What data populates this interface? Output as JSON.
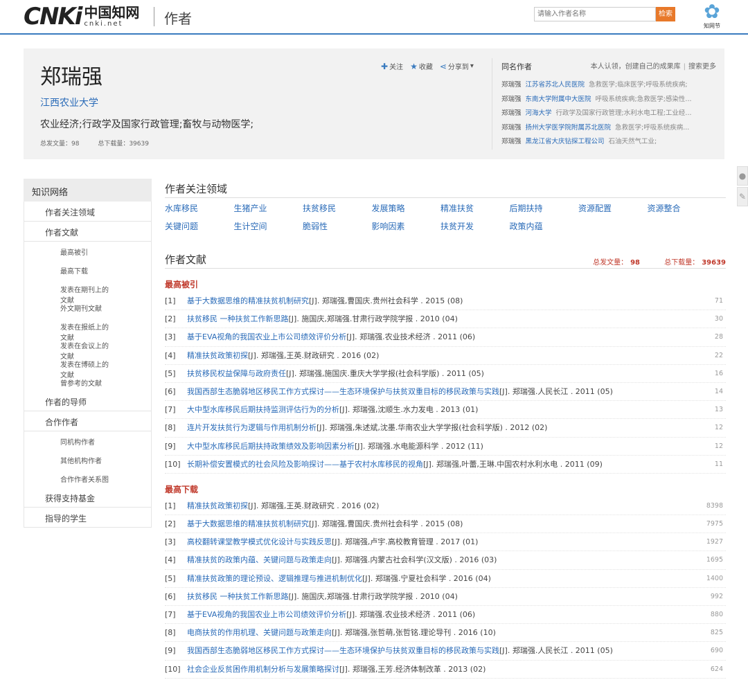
{
  "header": {
    "logo_cnki": "CNKi",
    "logo_zh": "中国知网",
    "logo_en": "cnki.net",
    "title": "作者",
    "search_placeholder": "请输入作者名称",
    "search_button": "检索",
    "brand_label": "知网节"
  },
  "author": {
    "name": "郑瑞强",
    "org": "江西农业大学",
    "fields": "农业经济;行政学及国家行政管理;畜牧与动物医学;",
    "stat_articles": "总发文量：98",
    "stat_downloads": "总下载量：39639",
    "actions": [
      "关注",
      "收藏",
      "分享到"
    ]
  },
  "same_name": {
    "title": "同名作者",
    "certify": "本人认领，创建自己的成果库",
    "search_more": "搜索更多",
    "rows": [
      {
        "name": "郑瑞强",
        "org": "江苏省苏北人民医院",
        "field": "急救医学;临床医学;呼吸系统疾病;"
      },
      {
        "name": "郑瑞强",
        "org": "东南大学附属中大医院",
        "field": "呼吸系统疾病;急救医学;感染性..."
      },
      {
        "name": "郑瑞强",
        "org": "河海大学",
        "field": "行政学及国家行政管理;水利水电工程;工业经..."
      },
      {
        "name": "郑瑞强",
        "org": "扬州大学医学院附属苏北医院",
        "field": "急救医学;呼吸系统疾病..."
      },
      {
        "name": "郑瑞强",
        "org": "黑龙江省大庆钻探工程公司",
        "field": "石油天然气工业;"
      }
    ]
  },
  "sidebar": {
    "head": "知识网络",
    "items": [
      {
        "label": "作者关注领域",
        "level": 1
      },
      {
        "label": "作者文献",
        "level": 1
      },
      {
        "label": "最高被引",
        "level": 2
      },
      {
        "label": "最高下载",
        "level": 2
      },
      {
        "label": "发表在期刊上的文献",
        "level": 2
      },
      {
        "label": "外文期刊文献",
        "level": 2
      },
      {
        "label": "发表在报纸上的文献",
        "level": 2
      },
      {
        "label": "发表在会议上的文献",
        "level": 2
      },
      {
        "label": "发表在博硕上的文献",
        "level": 2
      },
      {
        "label": "曾参考的文献",
        "level": 2
      },
      {
        "label": "作者的导师",
        "level": 1
      },
      {
        "label": "合作作者",
        "level": 1
      },
      {
        "label": "同机构作者",
        "level": 2
      },
      {
        "label": "其他机构作者",
        "level": 2
      },
      {
        "label": "合作作者关系图",
        "level": 2
      },
      {
        "label": "获得支持基金",
        "level": 1
      },
      {
        "label": "指导的学生",
        "level": 1
      }
    ]
  },
  "focus": {
    "title": "作者关注领域",
    "keywords": [
      "水库移民",
      "生猪产业",
      "扶贫移民",
      "发展策略",
      "精准扶贫",
      "后期扶持",
      "资源配置",
      "资源整合",
      "关键问题",
      "生计空间",
      "脆弱性",
      "影响因素",
      "扶贫开发",
      "政策内蕴"
    ]
  },
  "docs": {
    "title": "作者文献",
    "stat_articles_label": "总发文量：",
    "stat_articles": "98",
    "stat_downloads_label": "总下载量：",
    "stat_downloads": "39639",
    "groups": [
      {
        "title": "最高被引",
        "rows": [
          {
            "idx": "[1]",
            "title": "基于大数据思维的精准扶贫机制研究",
            "meta": "[J]. 郑瑞强,曹国庆.贵州社会科学 . 2015 (08)",
            "count": "71"
          },
          {
            "idx": "[2]",
            "title": "扶贫移民 一种扶贫工作新思路",
            "meta": "[J]. 施国庆,郑瑞强.甘肃行政学院学报 . 2010 (04)",
            "count": "30"
          },
          {
            "idx": "[3]",
            "title": "基于EVA视角的我国农业上市公司绩效评价分析",
            "meta": "[J]. 郑瑞强.农业技术经济 . 2011 (06)",
            "count": "28"
          },
          {
            "idx": "[4]",
            "title": "精准扶贫政策初探",
            "meta": "[J]. 郑瑞强,王英.财政研究 . 2016 (02)",
            "count": "22"
          },
          {
            "idx": "[5]",
            "title": "扶贫移民权益保障与政府责任",
            "meta": "[J]. 郑瑞强,施国庆.重庆大学学报(社会科学版) . 2011 (05)",
            "count": "16"
          },
          {
            "idx": "[6]",
            "title": "我国西部生态脆弱地区移民工作方式探讨——生态环境保护与扶贫双重目标的移民政策与实践",
            "meta": "[J]. 郑瑞强.人民长江 . 2011 (05)",
            "count": "14"
          },
          {
            "idx": "[7]",
            "title": "大中型水库移民后期扶持监测评估行为的分析",
            "meta": "[J]. 郑瑞强,沈顺生.水力发电 . 2013 (01)",
            "count": "13"
          },
          {
            "idx": "[8]",
            "title": "连片开发扶贫行为逻辑与作用机制分析",
            "meta": "[J]. 郑瑞强,朱述斌,沈墨.华南农业大学学报(社会科学版) . 2012 (02)",
            "count": "12"
          },
          {
            "idx": "[9]",
            "title": "大中型水库移民后期扶持政策绩效及影响因素分析",
            "meta": "[J]. 郑瑞强.水电能源科学 . 2012 (11)",
            "count": "12"
          },
          {
            "idx": "[10]",
            "title": "长期补偿安置模式的社会风险及影响探讨——基于农村水库移民的视角",
            "meta": "[J]. 郑瑞强,叶蕾,王琳.中国农村水利水电 . 2011 (09)",
            "count": "11"
          }
        ]
      },
      {
        "title": "最高下载",
        "rows": [
          {
            "idx": "[1]",
            "title": "精准扶贫政策初探",
            "meta": "[J]. 郑瑞强,王英.财政研究 . 2016 (02)",
            "count": "8398"
          },
          {
            "idx": "[2]",
            "title": "基于大数据思维的精准扶贫机制研究",
            "meta": "[J]. 郑瑞强,曹国庆.贵州社会科学 . 2015 (08)",
            "count": "7975"
          },
          {
            "idx": "[3]",
            "title": "高校翻转课堂教学模式优化设计与实践反思",
            "meta": "[J]. 郑瑞强,卢宇.高校教育管理 . 2017 (01)",
            "count": "1927"
          },
          {
            "idx": "[4]",
            "title": "精准扶贫的政策内蕴、关键问题与政策走向",
            "meta": "[J]. 郑瑞强.内蒙古社会科学(汉文版) . 2016 (03)",
            "count": "1695"
          },
          {
            "idx": "[5]",
            "title": "精准扶贫政策的理论预设、逻辑推理与推进机制优化",
            "meta": "[J]. 郑瑞强.宁夏社会科学 . 2016 (04)",
            "count": "1400"
          },
          {
            "idx": "[6]",
            "title": "扶贫移民 一种扶贫工作新思路",
            "meta": "[J]. 施国庆,郑瑞强.甘肃行政学院学报 . 2010 (04)",
            "count": "992"
          },
          {
            "idx": "[7]",
            "title": "基于EVA视角的我国农业上市公司绩效评价分析",
            "meta": "[J]. 郑瑞强.农业技术经济 . 2011 (06)",
            "count": "880"
          },
          {
            "idx": "[8]",
            "title": "电商扶贫的作用机理、关键问题与政策走向",
            "meta": "[J]. 郑瑞强,张哲萌,张哲铭.理论导刊 . 2016 (10)",
            "count": "825"
          },
          {
            "idx": "[9]",
            "title": "我国西部生态脆弱地区移民工作方式探讨——生态环境保护与扶贫双重目标的移民政策与实践",
            "meta": "[J]. 郑瑞强.人民长江 . 2011 (05)",
            "count": "690"
          },
          {
            "idx": "[10]",
            "title": "社会企业反贫困作用机制分析与发展策略探讨",
            "meta": "[J]. 郑瑞强,王芳.经济体制改革 . 2013 (02)",
            "count": "624"
          }
        ]
      }
    ]
  },
  "colors": {
    "accent": "#2a6bb8",
    "header_line": "#3a7bbf",
    "red": "#c0392b",
    "search_btn": "#e8792a"
  },
  "icons": {
    "follow": "plus-icon",
    "favorite": "star-icon",
    "share": "share-icon",
    "brand": "flower-icon"
  }
}
